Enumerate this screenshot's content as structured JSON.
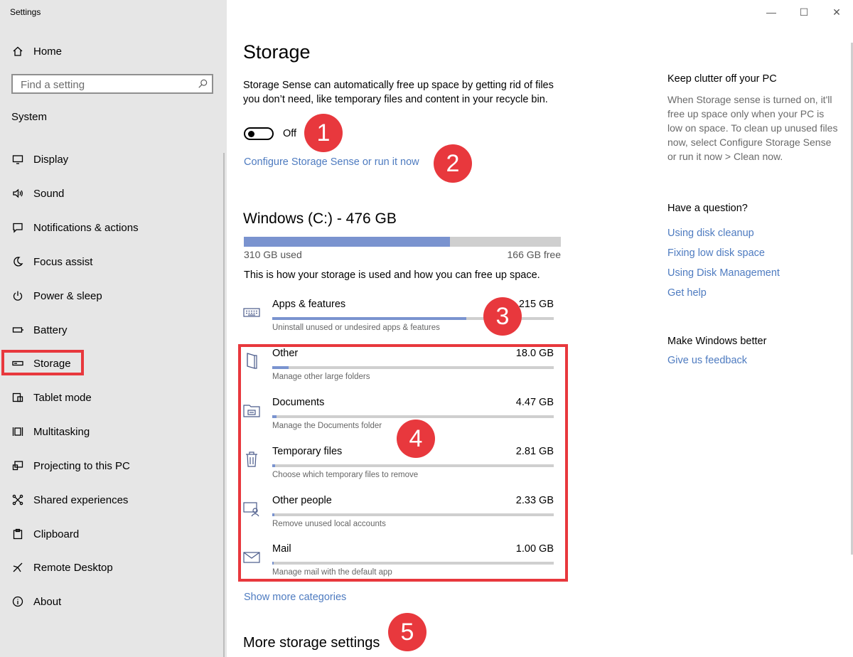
{
  "window": {
    "title": "Settings",
    "controls": {
      "minimize": "—",
      "maximize": "☐",
      "close": "✕"
    }
  },
  "sidebar": {
    "home_label": "Home",
    "search_placeholder": "Find a setting",
    "section_label": "System",
    "items": [
      {
        "label": "Display",
        "icon": "monitor-icon"
      },
      {
        "label": "Sound",
        "icon": "speaker-icon"
      },
      {
        "label": "Notifications & actions",
        "icon": "notification-icon"
      },
      {
        "label": "Focus assist",
        "icon": "moon-icon"
      },
      {
        "label": "Power & sleep",
        "icon": "power-icon"
      },
      {
        "label": "Battery",
        "icon": "battery-icon"
      },
      {
        "label": "Storage",
        "icon": "storage-drive-icon",
        "selected": true
      },
      {
        "label": "Tablet mode",
        "icon": "tablet-icon"
      },
      {
        "label": "Multitasking",
        "icon": "multitasking-icon"
      },
      {
        "label": "Projecting to this PC",
        "icon": "projecting-icon"
      },
      {
        "label": "Shared experiences",
        "icon": "shared-icon"
      },
      {
        "label": "Clipboard",
        "icon": "clipboard-icon"
      },
      {
        "label": "Remote Desktop",
        "icon": "remote-desktop-icon"
      },
      {
        "label": "About",
        "icon": "info-icon"
      }
    ]
  },
  "main": {
    "title": "Storage",
    "description": "Storage Sense can automatically free up space by getting rid of files you don’t need, like temporary files and content in your recycle bin.",
    "toggle_state": "Off",
    "configure_link": "Configure Storage Sense or run it now",
    "drive": {
      "title": "Windows (C:) - 476 GB",
      "used_label": "310 GB used",
      "free_label": "166 GB free",
      "used_fraction": 0.65
    },
    "how_text": "This is how your storage is used and how you can free up space.",
    "categories": [
      {
        "name": "Apps & features",
        "size": "215 GB",
        "sub": "Uninstall unused or undesired apps & features",
        "fraction": 0.69,
        "icon": "keyboard-icon"
      },
      {
        "name": "Other",
        "size": "18.0 GB",
        "sub": "Manage other large folders",
        "fraction": 0.058,
        "icon": "folder-page-icon"
      },
      {
        "name": "Documents",
        "size": "4.47 GB",
        "sub": "Manage the Documents folder",
        "fraction": 0.014,
        "icon": "documents-folder-icon"
      },
      {
        "name": "Temporary files",
        "size": "2.81 GB",
        "sub": "Choose which temporary files to remove",
        "fraction": 0.009,
        "icon": "trash-icon"
      },
      {
        "name": "Other people",
        "size": "2.33 GB",
        "sub": "Remove unused local accounts",
        "fraction": 0.008,
        "icon": "user-monitor-icon"
      },
      {
        "name": "Mail",
        "size": "1.00 GB",
        "sub": "Manage mail with the default app",
        "fraction": 0.003,
        "icon": "mail-icon"
      }
    ],
    "show_more": "Show more categories",
    "more_settings": "More storage settings"
  },
  "badges": [
    "1",
    "2",
    "3",
    "4",
    "5"
  ],
  "right_column": {
    "clutter_heading": "Keep clutter off your PC",
    "clutter_text": "When Storage sense is turned on, it'll free up space only when your PC is low on space. To clean up unused files now, select Configure Storage Sense or run it now > Clean now.",
    "question_heading": "Have a question?",
    "links": [
      "Using disk cleanup",
      "Fixing low disk space",
      "Using Disk Management",
      "Get help"
    ],
    "better_heading": "Make Windows better",
    "feedback_link": "Give us feedback"
  },
  "colors": {
    "accent_link": "#4e7bc0",
    "bar_fill": "#7a93cf",
    "highlight_red": "#e8383d",
    "sidebar_bg": "#e6e6e6"
  }
}
